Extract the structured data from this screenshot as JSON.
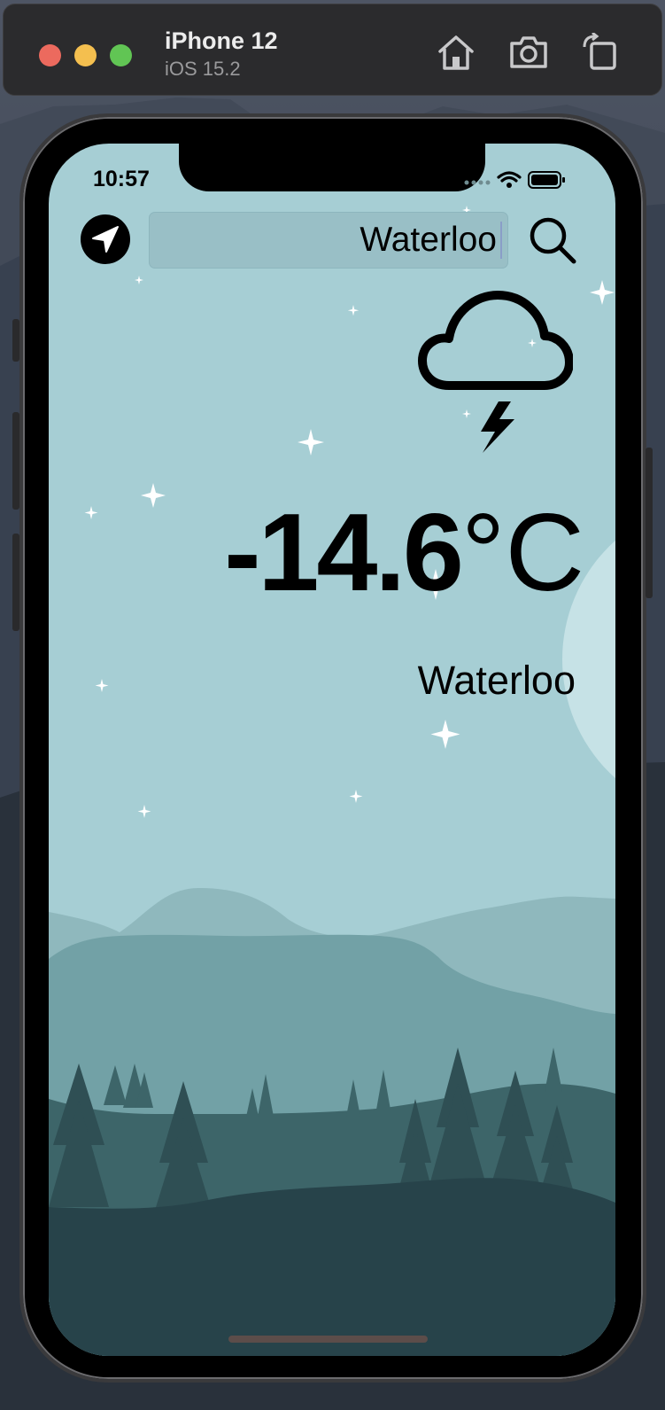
{
  "simulator": {
    "device_name": "iPhone 12",
    "os_version": "iOS 15.2",
    "toolbar_icons": [
      "home-icon",
      "screenshot-icon",
      "rotate-icon"
    ]
  },
  "status_bar": {
    "time": "10:57",
    "icons": [
      "signal-icon",
      "wifi-icon",
      "battery-icon"
    ]
  },
  "search": {
    "value": "Waterloo",
    "location_icon": "location-arrow-icon",
    "search_icon": "magnifier-icon"
  },
  "weather": {
    "icon": "cloud-bolt-icon",
    "temperature": "-14.6",
    "unit": "°C",
    "city": "Waterloo"
  },
  "colors": {
    "sky": "#a6ced4",
    "mountain_light": "#8fb8bd",
    "mountain_mid": "#72a1a6",
    "forest_mid": "#3d6569",
    "forest_dark": "#27434a",
    "moon": "#c6e2e6"
  }
}
